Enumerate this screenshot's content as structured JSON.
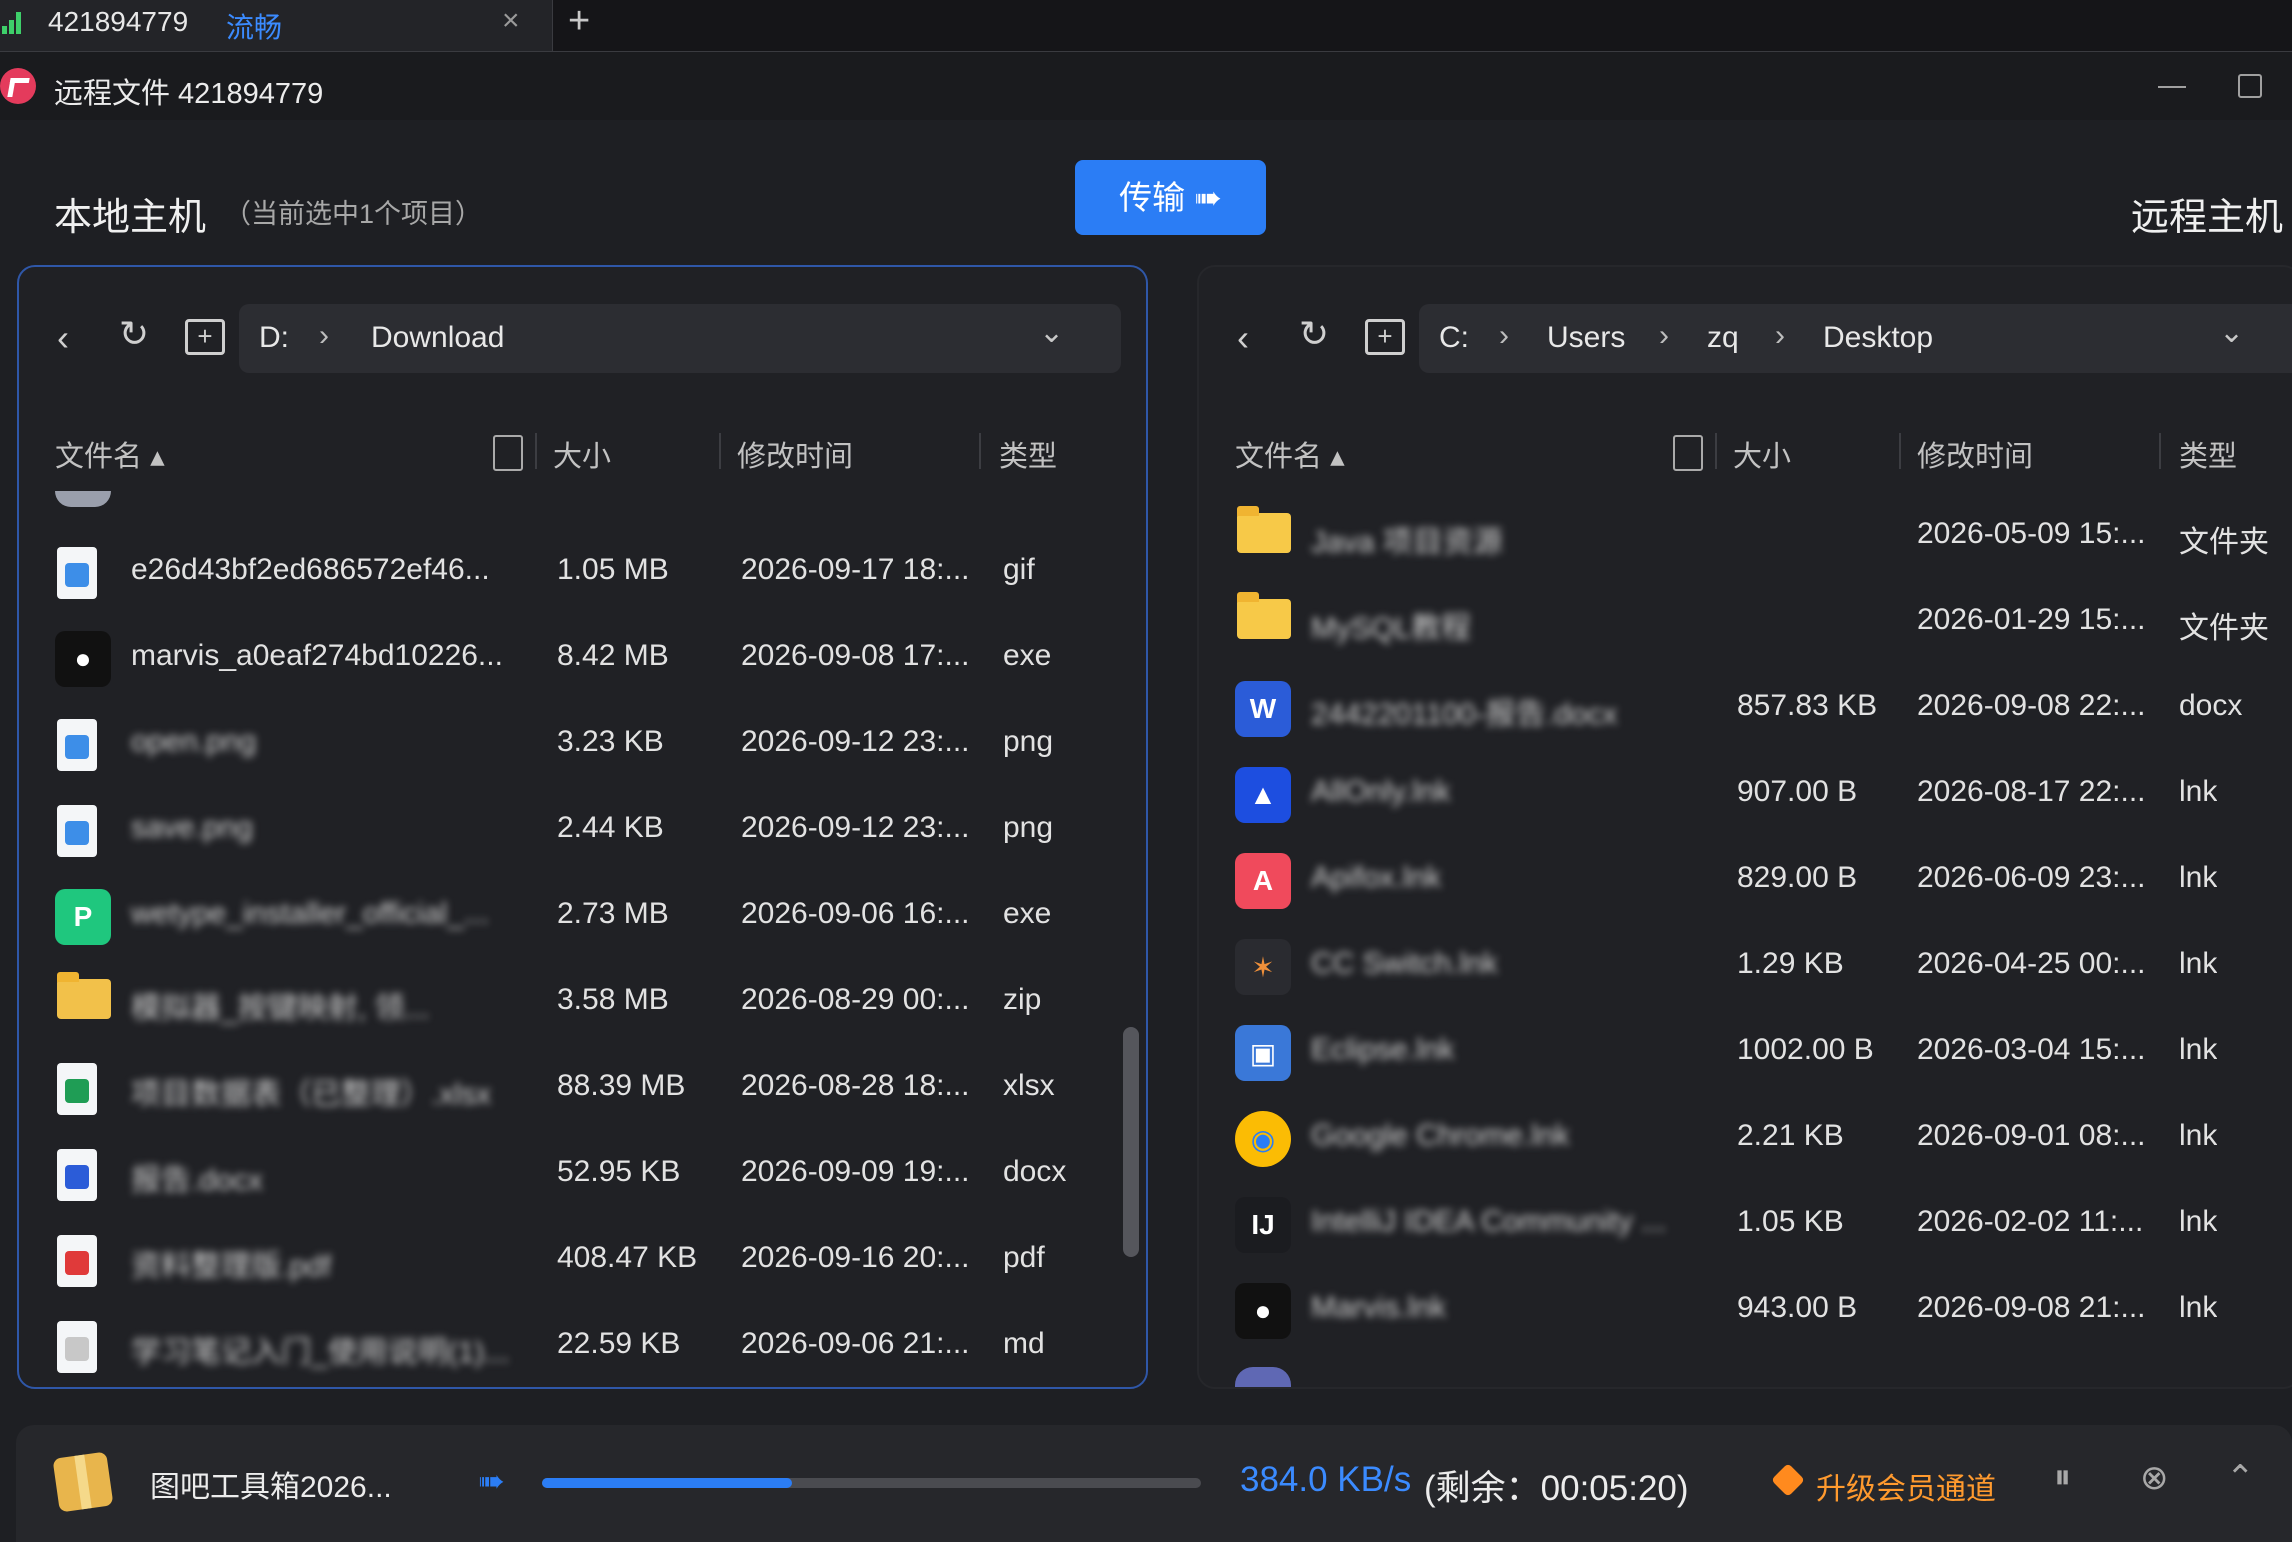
{
  "tab": {
    "id": "421894779",
    "quality": "流畅",
    "close": "×",
    "new": "+"
  },
  "window": {
    "title": "远程文件 421894779"
  },
  "local": {
    "title": "本地主机",
    "subtitle": "（当前选中1个项目）",
    "path": [
      "D:",
      "Download"
    ],
    "headers": {
      "name": "文件名",
      "size": "大小",
      "modified": "修改时间",
      "type": "类型"
    },
    "rows": [
      {
        "name": "e26d43bf2ed686572ef46...",
        "size": "1.05 MB",
        "modified": "2026-09-17 18:...",
        "type": "gif",
        "icon": "image",
        "blur": false
      },
      {
        "name": "marvis_a0eaf274bd10226...",
        "size": "8.42 MB",
        "modified": "2026-09-08 17:...",
        "type": "exe",
        "icon": "marvis",
        "blur": false
      },
      {
        "name": "open.png",
        "size": "3.23 KB",
        "modified": "2026-09-12 23:...",
        "type": "png",
        "icon": "image",
        "blur": true
      },
      {
        "name": "save.png",
        "size": "2.44 KB",
        "modified": "2026-09-12 23:...",
        "type": "png",
        "icon": "image",
        "blur": true
      },
      {
        "name": "wetype_installer_official_...",
        "size": "2.73 MB",
        "modified": "2026-09-06 16:...",
        "type": "exe",
        "icon": "wetype",
        "blur": true
      },
      {
        "name": "模拟器_按键映射, 领...",
        "size": "3.58 MB",
        "modified": "2026-08-29 00:...",
        "type": "zip",
        "icon": "zip",
        "blur": true
      },
      {
        "name": "项目数据表（已整理）.xlsx",
        "size": "88.39 MB",
        "modified": "2026-08-28 18:...",
        "type": "xlsx",
        "icon": "xlsx",
        "blur": true
      },
      {
        "name": "报告.docx",
        "size": "52.95 KB",
        "modified": "2026-09-09 19:...",
        "type": "docx",
        "icon": "docx",
        "blur": true
      },
      {
        "name": "资料整理版.pdf",
        "size": "408.47 KB",
        "modified": "2026-09-16 20:...",
        "type": "pdf",
        "icon": "pdf",
        "blur": true
      },
      {
        "name": "学习笔记入门_使用说明(1)...",
        "size": "22.59 KB",
        "modified": "2026-09-06 21:...",
        "type": "md",
        "icon": "md",
        "blur": true
      }
    ]
  },
  "remote": {
    "title": "远程主机",
    "path": [
      "C:",
      "Users",
      "zq",
      "Desktop"
    ],
    "headers": {
      "name": "文件名",
      "size": "大小",
      "modified": "修改时间",
      "type": "类型"
    },
    "rows": [
      {
        "name": "Java 项目资源",
        "size": "",
        "modified": "2026-05-09 15:...",
        "type": "文件夹",
        "icon": "folder",
        "blur": true
      },
      {
        "name": "MySQL教程",
        "size": "",
        "modified": "2026-01-29 15:...",
        "type": "文件夹",
        "icon": "folder",
        "blur": true
      },
      {
        "name": "2442201100-报告.docx",
        "size": "857.83 KB",
        "modified": "2026-09-08 22:...",
        "type": "docx",
        "icon": "word",
        "blur": true
      },
      {
        "name": "AllOnly.lnk",
        "size": "907.00 B",
        "modified": "2026-08-17 22:...",
        "type": "lnk",
        "icon": "allonly",
        "blur": true
      },
      {
        "name": "Apifox.lnk",
        "size": "829.00 B",
        "modified": "2026-06-09 23:...",
        "type": "lnk",
        "icon": "apifox",
        "blur": true
      },
      {
        "name": "CC Switch.lnk",
        "size": "1.29 KB",
        "modified": "2026-04-25 00:...",
        "type": "lnk",
        "icon": "ccswitch",
        "blur": true
      },
      {
        "name": "Eclipse.lnk",
        "size": "1002.00 B",
        "modified": "2026-03-04 15:...",
        "type": "lnk",
        "icon": "eclipse",
        "blur": true
      },
      {
        "name": "Google Chrome.lnk",
        "size": "2.21 KB",
        "modified": "2026-09-01 08:...",
        "type": "lnk",
        "icon": "chrome",
        "blur": true
      },
      {
        "name": "IntelliJ IDEA Community ...",
        "size": "1.05 KB",
        "modified": "2026-02-02 11:...",
        "type": "lnk",
        "icon": "idea",
        "blur": true
      },
      {
        "name": "Marvis.lnk",
        "size": "943.00 B",
        "modified": "2026-09-08 21:...",
        "type": "lnk",
        "icon": "marvis",
        "blur": true
      }
    ]
  },
  "buttons": {
    "transfer": "传输 ➠"
  },
  "transfer_task": {
    "name": "图吧工具箱2026...",
    "progress": 0.38,
    "speed": "384.0 KB/s",
    "remaining": "(剩余：00:05:20)",
    "upgrade": "升级会员通道"
  },
  "colors": {
    "accent": "#2b7df5",
    "background": "#1e1f23",
    "upgrade": "#ff9a2e"
  }
}
